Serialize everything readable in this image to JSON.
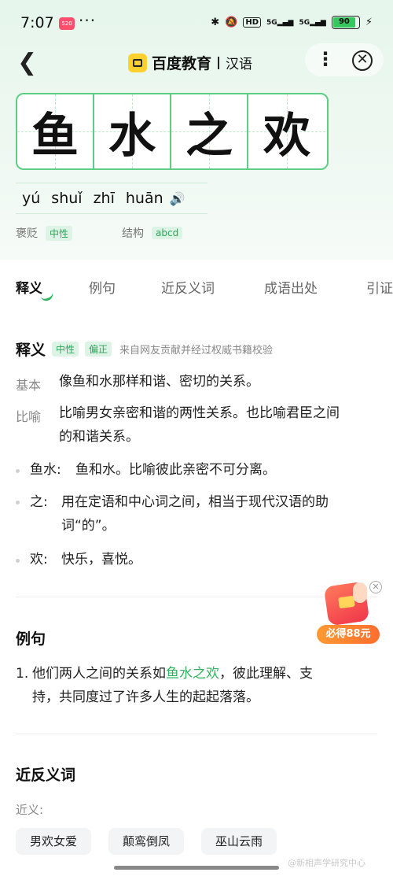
{
  "status_bar": {
    "time": "7:07",
    "app_badge": "520",
    "dots": "···",
    "hd": "HD",
    "signal1": "5G",
    "signal2": "5G",
    "battery": "90"
  },
  "header": {
    "brand": "百度教育",
    "section": "汉语",
    "more": "⋮",
    "close": "✕"
  },
  "idiom": {
    "chars": [
      "鱼",
      "水",
      "之",
      "欢"
    ],
    "pinyin": [
      "yú",
      "shuǐ",
      "zhī",
      "huān"
    ],
    "speaker": "🔊",
    "sentiment_label": "褒贬",
    "sentiment_value": "中性",
    "structure_label": "结构",
    "structure_value": "abcd"
  },
  "tabs": [
    "释义",
    "例句",
    "近反义词",
    "成语出处",
    "引证"
  ],
  "definition": {
    "title": "释义",
    "tag1": "中性",
    "tag2": "偏正",
    "source": "来自网友贡献并经过权威书籍校验",
    "basic_label": "基本",
    "basic_text": "像鱼和水那样和谐、密切的关系。",
    "metaphor_label": "比喻",
    "metaphor_line1": "比喻男女亲密和谐的两性关系。也比喻君臣之间",
    "metaphor_line2": "的和谐关系。",
    "words": [
      {
        "term": "鱼水:",
        "line1": "鱼和水。比喻彼此亲密不可分离。",
        "line2": ""
      },
      {
        "term": "之:",
        "line1": "用在定语和中心词之间，相当于现代汉语的助",
        "line2": "词“的”。"
      },
      {
        "term": "欢:",
        "line1": "快乐，喜悦。",
        "line2": ""
      }
    ]
  },
  "red_packet": {
    "label": "必得88元",
    "close": "✕"
  },
  "examples": {
    "title": "例句",
    "item_number": "1.",
    "line1_before": "他们两人之间的关系如",
    "line1_highlight": "鱼水之欢",
    "line1_after": "，彼此理解、支",
    "line2": "持，共同度过了许多人生的起起落落。"
  },
  "synonyms": {
    "title": "近反义词",
    "near_label": "近义:",
    "chips": [
      "男欢女爱",
      "颠鸾倒凤",
      "巫山云雨"
    ]
  },
  "watermark": "@新相声学研究中心",
  "colors": {
    "accent": "#2fb45d",
    "grid_border": "#5ccf84",
    "tag_bg": "#ddf3e5"
  }
}
